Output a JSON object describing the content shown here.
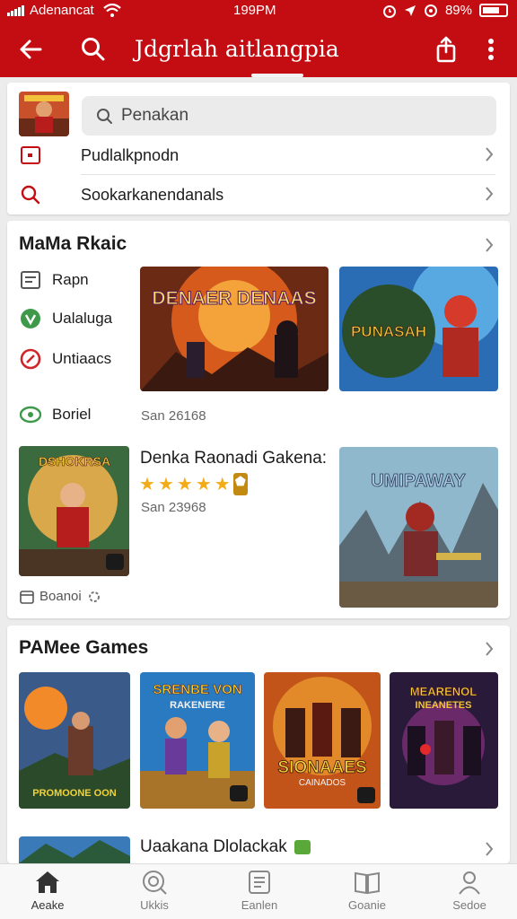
{
  "status_bar": {
    "carrier": "Adenancat",
    "time": "199PM",
    "battery": "89%"
  },
  "app_bar": {
    "title": "Jdgrlah aitlangpia"
  },
  "account": {
    "search_placeholder": "Penakan"
  },
  "quick_links": [
    {
      "label": "Pudlalkpnodn"
    },
    {
      "label": "Sookarkanendanals"
    }
  ],
  "featured": {
    "title": "MaMa Rkaic",
    "menu": [
      {
        "label": "Rapn"
      },
      {
        "label": "Ualaluga"
      },
      {
        "label": "Untiaacs"
      },
      {
        "label": "Boriel"
      }
    ],
    "art_titles": [
      "DENAER DENAAS",
      "PUNASAH"
    ],
    "meta1": "San 26168",
    "game": {
      "title": "Denka Raonadi Gakena:",
      "rating": 4.5,
      "meta": "San 23968",
      "footer": "Boanoi",
      "art_title": "DSHOKRSA"
    },
    "art_title_right": "UMIPAWAY"
  },
  "games": {
    "title": "PAMee Games",
    "tiles": [
      {
        "title": "PROMOONE OON"
      },
      {
        "title": "SRENBE VON",
        "subtitle": "RAKENERE"
      },
      {
        "title": "SIONAAES",
        "subtitle": "CAINADOS"
      },
      {
        "title": "MEARENOL",
        "subtitle": "INEANETES"
      }
    ],
    "next_row_title": "Uaakana Dlolackak"
  },
  "bottom_nav": [
    {
      "label": "Aeake",
      "active": true
    },
    {
      "label": "Ukkis"
    },
    {
      "label": "Eanlen"
    },
    {
      "label": "Goanie"
    },
    {
      "label": "Sedoe"
    }
  ],
  "colors": {
    "brand": "#c40d12",
    "star": "#f2ac19",
    "badge_green": "#5aa83a"
  }
}
